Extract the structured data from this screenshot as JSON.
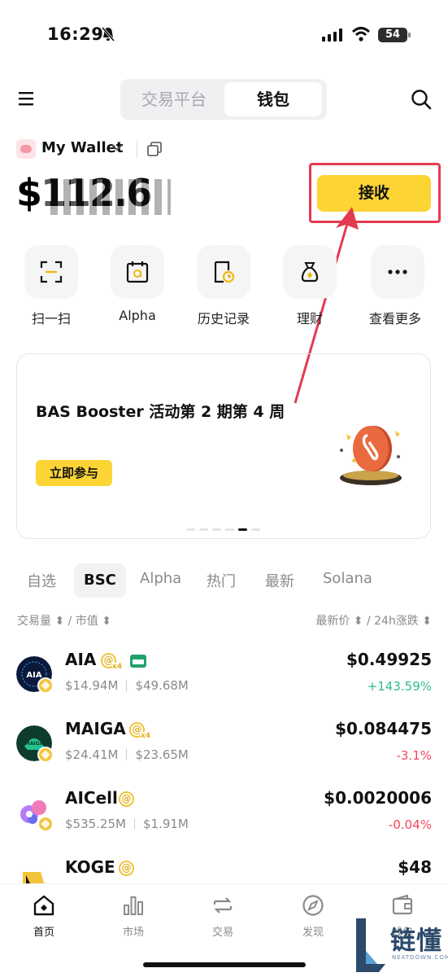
{
  "status_bar": {
    "time": "16:29",
    "battery": "54"
  },
  "header": {
    "tabs": [
      "交易平台",
      "钱包"
    ],
    "active_tab": "钱包"
  },
  "wallet": {
    "name": "My Wallet",
    "balance_masked": "$112.6"
  },
  "receive_button": {
    "label": "接收"
  },
  "quick_actions": [
    {
      "label": "扫一扫",
      "icon": "scan-icon"
    },
    {
      "label": "Alpha",
      "icon": "alpha-calendar-icon"
    },
    {
      "label": "历史记录",
      "icon": "history-icon"
    },
    {
      "label": "理财",
      "icon": "money-bag-icon"
    },
    {
      "label": "查看更多",
      "icon": "more-dots-icon"
    }
  ],
  "banner": {
    "title": "BAS Booster 活动第 2 期第 4 周",
    "button": "立即参与",
    "active_dot": 5,
    "dot_count": 6
  },
  "market_tabs": [
    "自选",
    "BSC",
    "Alpha",
    "热门",
    "最新",
    "Solana"
  ],
  "active_market_tab": "BSC",
  "sort_header": {
    "left": "交易量 ⬍ / 市值 ⬍",
    "right": "最新价 ⬍ / 24h涨跌 ⬍"
  },
  "tokens": [
    {
      "symbol": "AIA",
      "volume": "$14.94M",
      "mcap": "$49.68M",
      "price": "$0.49925",
      "change": "+143.59%",
      "dir": "up",
      "alpha_multiplier": "x4"
    },
    {
      "symbol": "MAIGA",
      "volume": "$24.41M",
      "mcap": "$23.65M",
      "price": "$0.084475",
      "change": "-3.1%",
      "dir": "down",
      "alpha_multiplier": "x4"
    },
    {
      "symbol": "AICell",
      "volume": "$535.25M",
      "mcap": "$1.91M",
      "price": "$0.0020006",
      "change": "-0.04%",
      "dir": "down"
    },
    {
      "symbol": "KOGE",
      "price": "$48"
    }
  ],
  "bottom_nav": [
    {
      "label": "首页",
      "icon": "home-icon",
      "active": true
    },
    {
      "label": "市场",
      "icon": "market-chart-icon",
      "active": false
    },
    {
      "label": "交易",
      "icon": "trade-arrows-icon",
      "active": false
    },
    {
      "label": "发现",
      "icon": "compass-icon",
      "active": false
    },
    {
      "label": "钱包",
      "icon": "wallet-icon",
      "active": false
    }
  ],
  "watermark": {
    "text": "链懂",
    "sub": "NEATDOWN.COM"
  },
  "colors": {
    "brand_yellow": "#fcd535",
    "up": "#2ebd85",
    "down": "#f6465d",
    "highlight_red": "#e53950"
  }
}
